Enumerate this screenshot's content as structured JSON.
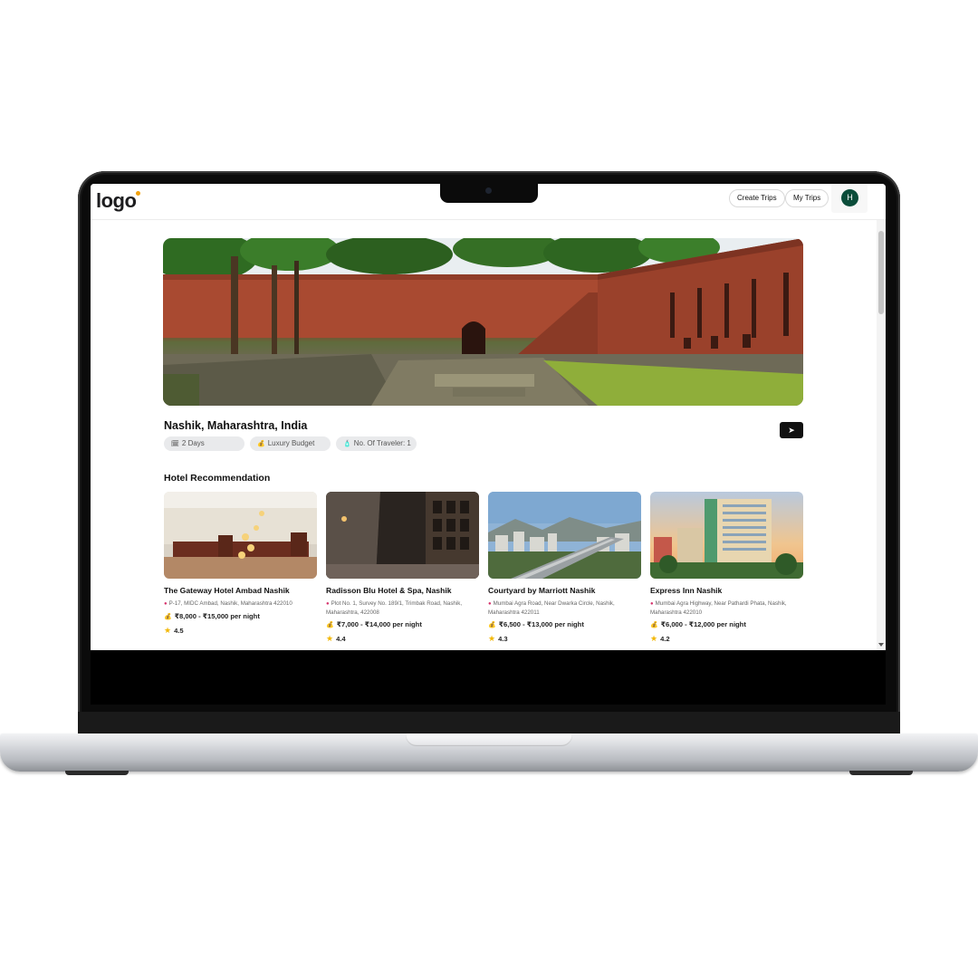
{
  "header": {
    "logo_text": "logo",
    "create_trips_label": "Create Trips",
    "my_trips_label": "My Trips",
    "avatar_initial": "H"
  },
  "trip": {
    "location": "Nashik, Maharashtra, India",
    "days_chip": "2 Days",
    "budget_chip": "Luxury Budget",
    "travelers_chip": "No. Of Traveler: 1",
    "share_icon": "send-icon"
  },
  "hotels_section": {
    "title": "Hotel Recommendation",
    "items": [
      {
        "name": "The Gateway Hotel Ambad Nashik",
        "address": "P-17, MIDC Ambad, Nashik, Maharashtra 422010",
        "price": "₹8,000 - ₹15,000 per night",
        "rating": "4.5"
      },
      {
        "name": "Radisson Blu Hotel & Spa, Nashik",
        "address": "Plot No. 1, Survey No. 189/1, Trimbak Road, Nashik, Maharashtra, 422008",
        "price": "₹7,000 - ₹14,000 per night",
        "rating": "4.4"
      },
      {
        "name": "Courtyard by Marriott Nashik",
        "address": "Mumbai Agra Road, Near Dwarka Circle, Nashik, Maharashtra 422011",
        "price": "₹6,500 - ₹13,000 per night",
        "rating": "4.3"
      },
      {
        "name": "Express Inn Nashik",
        "address": "Mumbai Agra Highway, Near Pathardi Phata, Nashik, Maharashtra 422010",
        "price": "₹6,000 - ₹12,000 per night",
        "rating": "4.2"
      }
    ]
  },
  "colors": {
    "avatar_bg": "#0b4d3a",
    "chip_bg": "#e9eaec",
    "star": "#f2b705",
    "pin": "#d6336c"
  }
}
